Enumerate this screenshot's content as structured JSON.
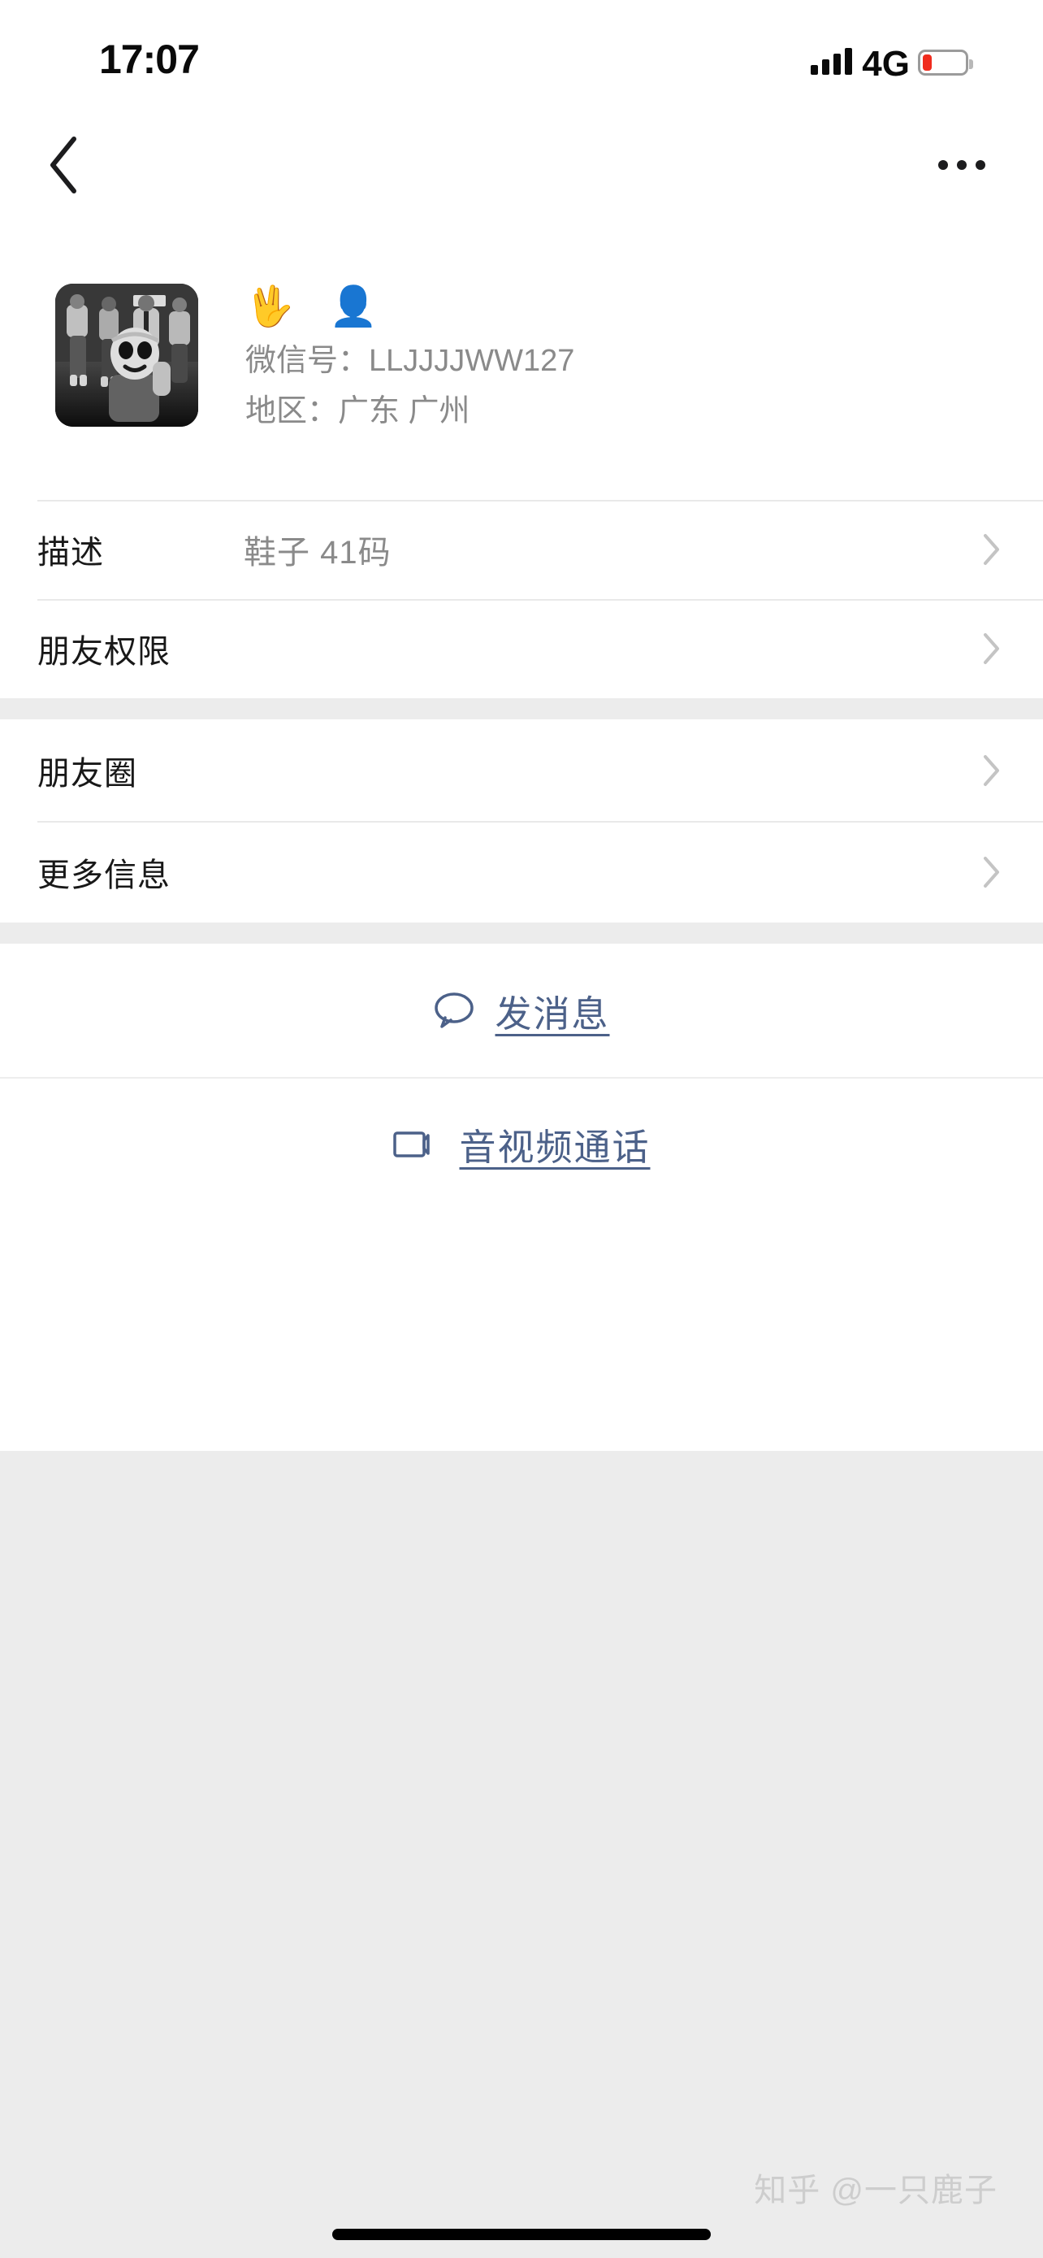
{
  "status_bar": {
    "time": "17:07",
    "network": "4G",
    "signal_icon": "signal-bars-icon",
    "battery_icon": "battery-low-icon",
    "battery_level_percent": 15,
    "battery_color": "#f02b1d"
  },
  "nav": {
    "back_icon": "chevron-left-icon",
    "more_icon": "ellipsis-icon",
    "title": ""
  },
  "profile": {
    "avatar_alt": "grayscale-group-photo-avatar",
    "display_name": "🖖 👤",
    "display_name_emojis": [
      "raised-hand-splayed-emoji",
      "business-person-emoji"
    ],
    "wechat_id_label": "微信号：",
    "wechat_id_value": "LLJJJJWW127",
    "wechat_id_line": "微信号：LLJJJJWW127",
    "region_label": "地区：",
    "region_value": "广东 广州",
    "region_line": "地区：广东 广州"
  },
  "list_group_1": [
    {
      "label": "描述",
      "value": "鞋子 41码",
      "chevron": "chevron-right-icon"
    },
    {
      "label": "朋友权限",
      "value": "",
      "chevron": "chevron-right-icon"
    }
  ],
  "list_group_2": [
    {
      "label": "朋友圈",
      "value": "",
      "chevron": "chevron-right-icon"
    },
    {
      "label": "更多信息",
      "value": "",
      "chevron": "chevron-right-icon"
    }
  ],
  "actions": [
    {
      "label": "发消息",
      "icon": "chat-bubble-icon"
    },
    {
      "label": "音视频通话",
      "icon": "video-camera-icon"
    }
  ],
  "watermark": "知乎 @一只鹿子",
  "colors": {
    "accent_link": "#4c6189",
    "background_gray": "#ececec",
    "card_white": "#ffffff",
    "text_primary": "#181818",
    "text_secondary": "#8a8a8a",
    "hairline": "#e9e9e9"
  }
}
